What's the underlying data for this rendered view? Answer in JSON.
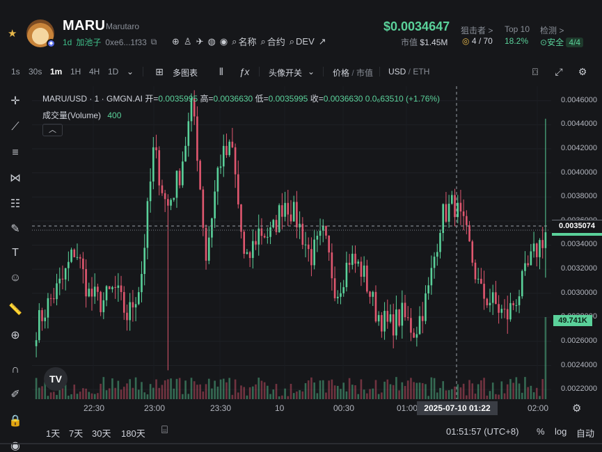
{
  "token": {
    "symbol": "MARU",
    "name": "Marutaro",
    "age": "1d",
    "pool_label": "加池子",
    "contract": "0xe6...1f33",
    "links": {
      "name": "名称",
      "contract": "合约",
      "dev": "DEV"
    },
    "price": "$0.0034647",
    "mcap_label": "市值",
    "mcap_value": "$1.45M"
  },
  "stats": {
    "snipers_label": "狙击者 >",
    "snipers_value": "4 / 70",
    "top10_label": "Top 10",
    "top10_value": "18.2%",
    "check_label": "检测 >",
    "check_value": "安全",
    "check_count": "4/4"
  },
  "toolbar": {
    "intervals": [
      "1s",
      "30s",
      "1m",
      "1H",
      "4H",
      "1D"
    ],
    "active_interval": "1m",
    "multi_chart": "多图表",
    "avatar_toggle": "头像开关",
    "price_label": "价格",
    "mcap_label": "市值",
    "currency_usd": "USD",
    "currency_eth": "ETH"
  },
  "chart": {
    "legend_symbol": "MARU/USD · 1 · GMGN.AI",
    "ohlc": {
      "open_label": "开",
      "open": "0.0035995",
      "high_label": "高",
      "high": "0.0036630",
      "low_label": "低",
      "low": "0.0035995",
      "close_label": "收",
      "close": "0.0036630",
      "change": "0.0₆63510 (+1.76%)"
    },
    "volume_label": "成交量(Volume)",
    "volume_value": "400",
    "current_price_tag": "0.0035074",
    "volume_tag": "49.741K",
    "cursor_time": "2025-07-10  01:22",
    "tv_logo": "TV",
    "y_ticks": [
      "0.0046000",
      "0.0044000",
      "0.0042000",
      "0.0040000",
      "0.0038000",
      "0.0036000",
      "0.0034000",
      "0.0032000",
      "0.0030000",
      "0.0028000",
      "0.0026000",
      "0.0024000",
      "0.0022000"
    ],
    "x_ticks": [
      "22:30",
      "23:00",
      "23:30",
      "10",
      "00:30",
      "01:00",
      "02:00"
    ]
  },
  "chart_data": {
    "type": "candlestick",
    "title": "MARU/USD · 1 · GMGN.AI",
    "ylim": [
      0.00212,
      0.00472
    ],
    "y_ticks": [
      0.0046,
      0.0044,
      0.0042,
      0.004,
      0.0038,
      0.0036,
      0.0034,
      0.0032,
      0.003,
      0.0028,
      0.0026,
      0.0024,
      0.0022
    ],
    "x_ticks": [
      "22:30",
      "23:00",
      "23:30",
      "10",
      "00:30",
      "01:00",
      "02:00"
    ],
    "colors": {
      "up": "#5ad19a",
      "down": "#e0576f"
    },
    "anchors_close": [
      0.00272,
      0.00293,
      0.0031,
      0.00338,
      0.003,
      0.00292,
      0.00304,
      0.0028,
      0.0031,
      0.0042,
      0.0037,
      0.004,
      0.0046,
      0.0033,
      0.0041,
      0.0042,
      0.0032,
      0.00352,
      0.00348,
      0.00378,
      0.0036,
      0.0033,
      0.00348,
      0.003,
      0.0033,
      0.00318,
      0.00285,
      0.00272,
      0.00282,
      0.00268,
      0.003,
      0.00363,
      0.00375,
      0.00345,
      0.003,
      0.00292,
      0.0028,
      0.00302,
      0.0033,
      0.0035
    ],
    "volume_max_label": "49.741K"
  },
  "bottom": {
    "ranges": [
      "1天",
      "7天",
      "30天",
      "180天"
    ],
    "clock": "01:51:57 (UTC+8)",
    "pct": "%",
    "log": "log",
    "auto": "自动"
  },
  "colors": {
    "up": "#5ad19a",
    "down": "#e0576f",
    "bg": "#16171a"
  }
}
